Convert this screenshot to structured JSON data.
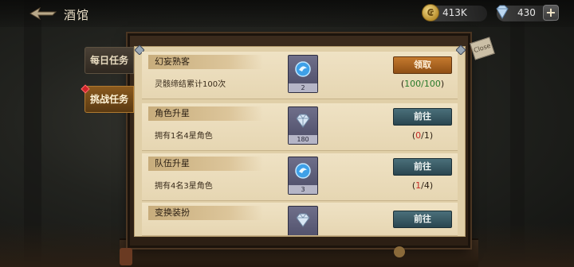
{
  "header": {
    "title": "酒馆",
    "coins": {
      "value": "413K"
    },
    "gems": {
      "value": "430"
    },
    "plus_label": "+"
  },
  "tabs": [
    {
      "label": "每日任务",
      "active": false
    },
    {
      "label": "挑战任务",
      "active": true
    }
  ],
  "board": {
    "corner_tag": "Close"
  },
  "tasks": [
    {
      "title": "幻妄熟客",
      "desc": "灵骸缔结累计100次",
      "reward_count": "2",
      "reward_icon": "spirit-orb-icon",
      "button": "领取",
      "button_type": "claim",
      "progress_current": "100",
      "progress_total": "100"
    },
    {
      "title": "角色升星",
      "desc": "拥有1名4星角色",
      "reward_count": "180",
      "reward_icon": "diamond-icon",
      "button": "前往",
      "button_type": "go",
      "progress_current": "0",
      "progress_total": "1"
    },
    {
      "title": "队伍升星",
      "desc": "拥有4名3星角色",
      "reward_count": "3",
      "reward_icon": "spirit-orb-icon",
      "button": "前往",
      "button_type": "go",
      "progress_current": "1",
      "progress_total": "4"
    },
    {
      "title": "变换装扮",
      "desc": "",
      "reward_count": "",
      "reward_icon": "diamond-icon",
      "button": "前往",
      "button_type": "go",
      "progress_current": "",
      "progress_total": ""
    }
  ],
  "colors": {
    "claim": "#c57a2e",
    "go": "#2a4650",
    "done": "#287a2b",
    "pending": "#c62b26"
  }
}
